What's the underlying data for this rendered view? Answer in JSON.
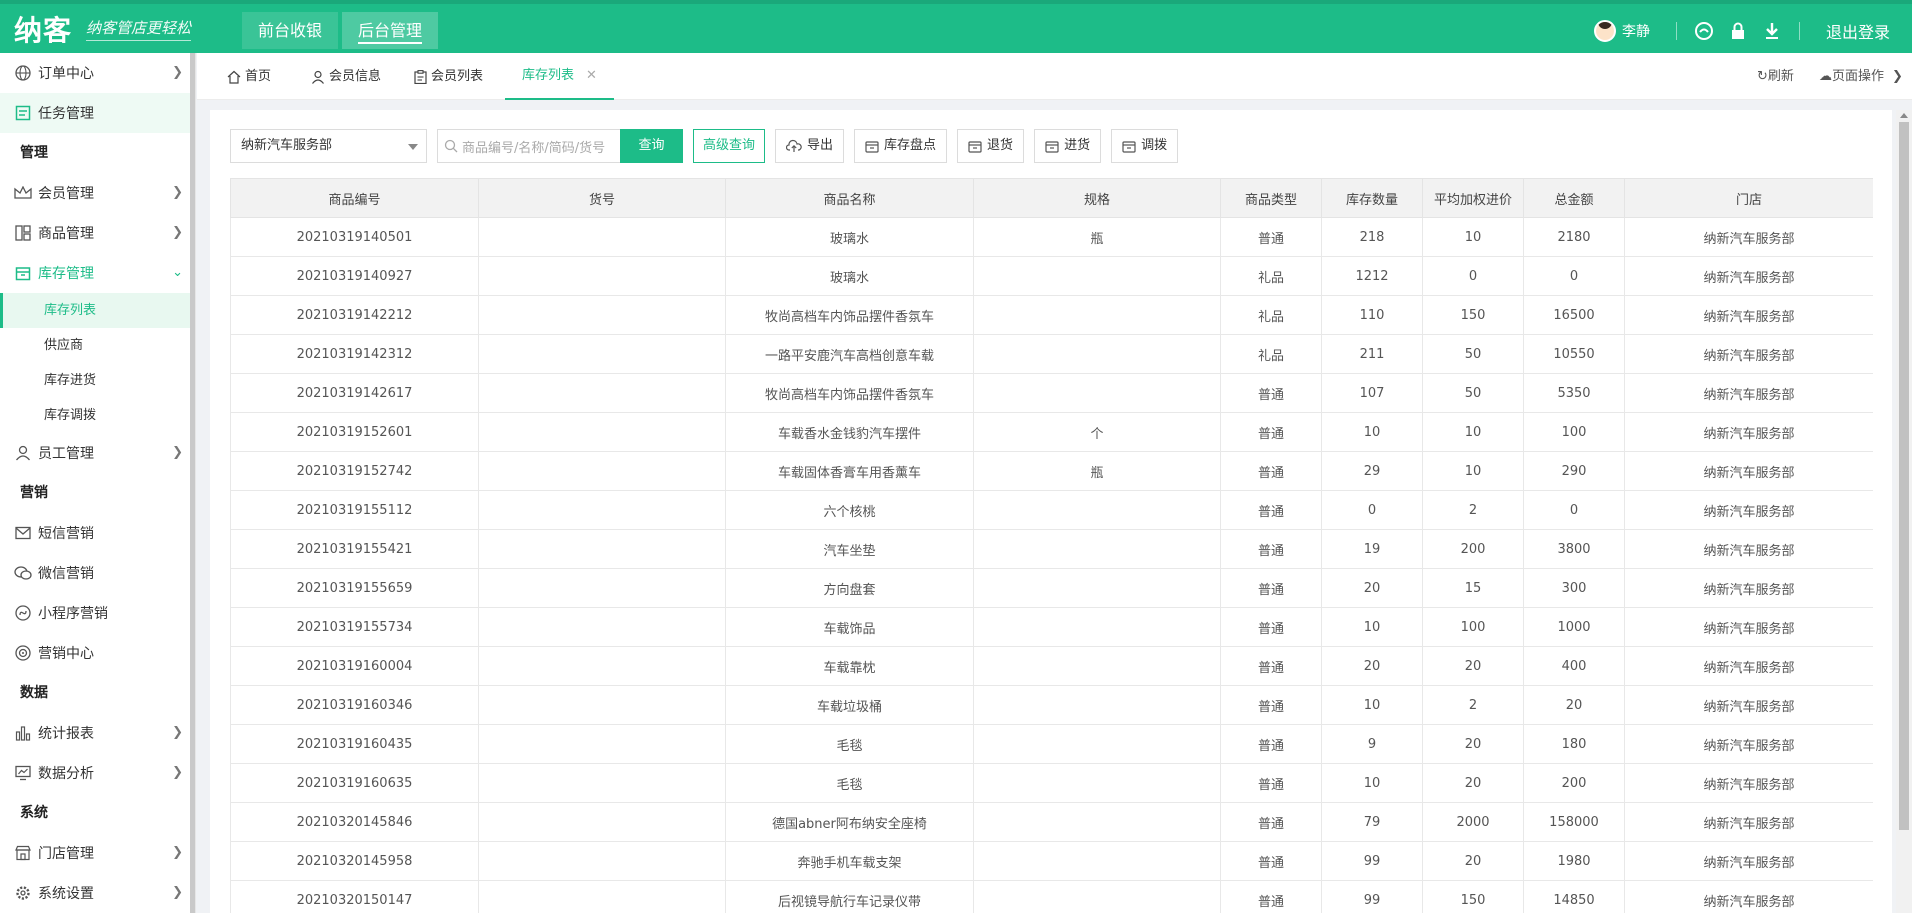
{
  "brand": {
    "logo": "纳客",
    "slogan": "纳客管店更轻松"
  },
  "topnav": {
    "front_label": "前台收银",
    "back_label": "后台管理"
  },
  "user": {
    "name": "李静",
    "logout_label": "退出登录"
  },
  "sidebar": {
    "order_center": "订单中心",
    "task_manage": "任务管理",
    "group_manage": "管理",
    "member_manage": "会员管理",
    "goods_manage": "商品管理",
    "stock_manage": "库存管理",
    "stock_list": "库存列表",
    "supplier": "供应商",
    "stock_in": "库存进货",
    "stock_transfer": "库存调拨",
    "staff_manage": "员工管理",
    "group_marketing": "营销",
    "sms_marketing": "短信营销",
    "wechat_marketing": "微信营销",
    "miniapp_marketing": "小程序营销",
    "marketing_center": "营销中心",
    "group_data": "数据",
    "report": "统计报表",
    "analysis": "数据分析",
    "group_system": "系统",
    "store_manage": "门店管理",
    "system_settings": "系统设置"
  },
  "tabs": {
    "home": "首页",
    "member_info": "会员信息",
    "member_list": "会员列表",
    "stock_list": "库存列表",
    "refresh": "刷新",
    "page_ops": "页面操作"
  },
  "toolbar": {
    "store_select": "纳新汽车服务部",
    "search_placeholder": "商品编号/名称/简码/货号",
    "query": "查询",
    "advanced": "高级查询",
    "export": "导出",
    "inventory": "库存盘点",
    "return": "退货",
    "purchase": "进货",
    "transfer": "调拨"
  },
  "table": {
    "headers": [
      "商品编号",
      "货号",
      "商品名称",
      "规格",
      "商品类型",
      "库存数量",
      "平均加权进价",
      "总金额",
      "门店"
    ],
    "rows": [
      [
        "20210319140501",
        "",
        "玻璃水",
        "瓶",
        "普通",
        "218",
        "10",
        "2180",
        "纳新汽车服务部"
      ],
      [
        "20210319140927",
        "",
        "玻璃水",
        "",
        "礼品",
        "1212",
        "0",
        "0",
        "纳新汽车服务部"
      ],
      [
        "20210319142212",
        "",
        "牧尚高档车内饰品摆件香氛车",
        "",
        "礼品",
        "110",
        "150",
        "16500",
        "纳新汽车服务部"
      ],
      [
        "20210319142312",
        "",
        "一路平安鹿汽车高档创意车载",
        "",
        "礼品",
        "211",
        "50",
        "10550",
        "纳新汽车服务部"
      ],
      [
        "20210319142617",
        "",
        "牧尚高档车内饰品摆件香氛车",
        "",
        "普通",
        "107",
        "50",
        "5350",
        "纳新汽车服务部"
      ],
      [
        "20210319152601",
        "",
        "车载香水金钱豹汽车摆件",
        "个",
        "普通",
        "10",
        "10",
        "100",
        "纳新汽车服务部"
      ],
      [
        "20210319152742",
        "",
        "车载固体香膏车用香薰车",
        "瓶",
        "普通",
        "29",
        "10",
        "290",
        "纳新汽车服务部"
      ],
      [
        "20210319155112",
        "",
        "六个核桃",
        "",
        "普通",
        "0",
        "2",
        "0",
        "纳新汽车服务部"
      ],
      [
        "20210319155421",
        "",
        "汽车坐垫",
        "",
        "普通",
        "19",
        "200",
        "3800",
        "纳新汽车服务部"
      ],
      [
        "20210319155659",
        "",
        "方向盘套",
        "",
        "普通",
        "20",
        "15",
        "300",
        "纳新汽车服务部"
      ],
      [
        "20210319155734",
        "",
        "车载饰品",
        "",
        "普通",
        "10",
        "100",
        "1000",
        "纳新汽车服务部"
      ],
      [
        "20210319160004",
        "",
        "车载靠枕",
        "",
        "普通",
        "20",
        "20",
        "400",
        "纳新汽车服务部"
      ],
      [
        "20210319160346",
        "",
        "车载垃圾桶",
        "",
        "普通",
        "10",
        "2",
        "20",
        "纳新汽车服务部"
      ],
      [
        "20210319160435",
        "",
        "毛毯",
        "",
        "普通",
        "9",
        "20",
        "180",
        "纳新汽车服务部"
      ],
      [
        "20210319160635",
        "",
        "毛毯",
        "",
        "普通",
        "10",
        "20",
        "200",
        "纳新汽车服务部"
      ],
      [
        "20210320145846",
        "",
        "德国abner阿布纳安全座椅",
        "",
        "普通",
        "79",
        "2000",
        "158000",
        "纳新汽车服务部"
      ],
      [
        "20210320145958",
        "",
        "奔驰手机车载支架",
        "",
        "普通",
        "99",
        "20",
        "1980",
        "纳新汽车服务部"
      ],
      [
        "20210320150147",
        "",
        "后视镜导航行车记录仪带",
        "",
        "普通",
        "99",
        "150",
        "14850",
        "纳新汽车服务部"
      ]
    ]
  },
  "colors": {
    "brand": "#1dbc88",
    "header_bg": "#f2f2f2"
  }
}
